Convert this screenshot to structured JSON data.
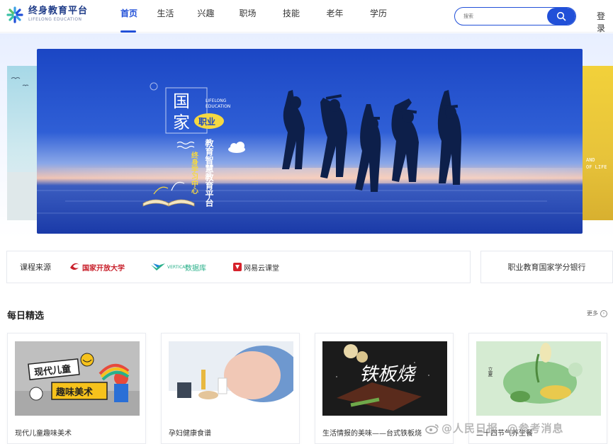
{
  "header": {
    "logo_cn": "终身教育平台",
    "logo_en": "LIFELONG EDUCATION",
    "nav": [
      {
        "label": "首页",
        "active": true
      },
      {
        "label": "生活",
        "active": false
      },
      {
        "label": "兴趣",
        "active": false
      },
      {
        "label": "职场",
        "active": false
      },
      {
        "label": "技能",
        "active": false
      },
      {
        "label": "老年",
        "active": false
      },
      {
        "label": "学历",
        "active": false
      }
    ],
    "search_placeholder": "搜索",
    "login": "登录",
    "accent": "#2150d8"
  },
  "banner": {
    "title_line1": "国",
    "title_line2": "家",
    "tag": "职业",
    "en_line1": "LIFELONG",
    "en_line2": "EDUCATION",
    "vertical_main": "教育智慧教育平台",
    "vertical_sub": "终身学习中心"
  },
  "side_right_text": "AND\nOF LIFE",
  "sources": {
    "label": "课程来源",
    "items": [
      {
        "name": "国家开放大学",
        "icon": "ouchn-logo-icon"
      },
      {
        "name": "数据库",
        "prefix": "VERTICAL",
        "icon": "database-logo-icon"
      },
      {
        "name": "网易云课堂",
        "icon": "netease-logo-icon"
      }
    ]
  },
  "credit_bank": "职业教育国家学分银行",
  "daily": {
    "title": "每日精选",
    "more": "更多",
    "cards": [
      {
        "title": "现代儿童趣味美术",
        "thumb_line1": "现代儿童",
        "thumb_line2": "趣味美术"
      },
      {
        "title": "孕妇健康食谱"
      },
      {
        "title": "生活情报的美味——台式铁板烧",
        "thumb_text": "铁板烧"
      },
      {
        "title": "二十四节气养生餐",
        "thumb_text": "立夏"
      }
    ]
  },
  "watermark": "@人民日报  @参考消息"
}
